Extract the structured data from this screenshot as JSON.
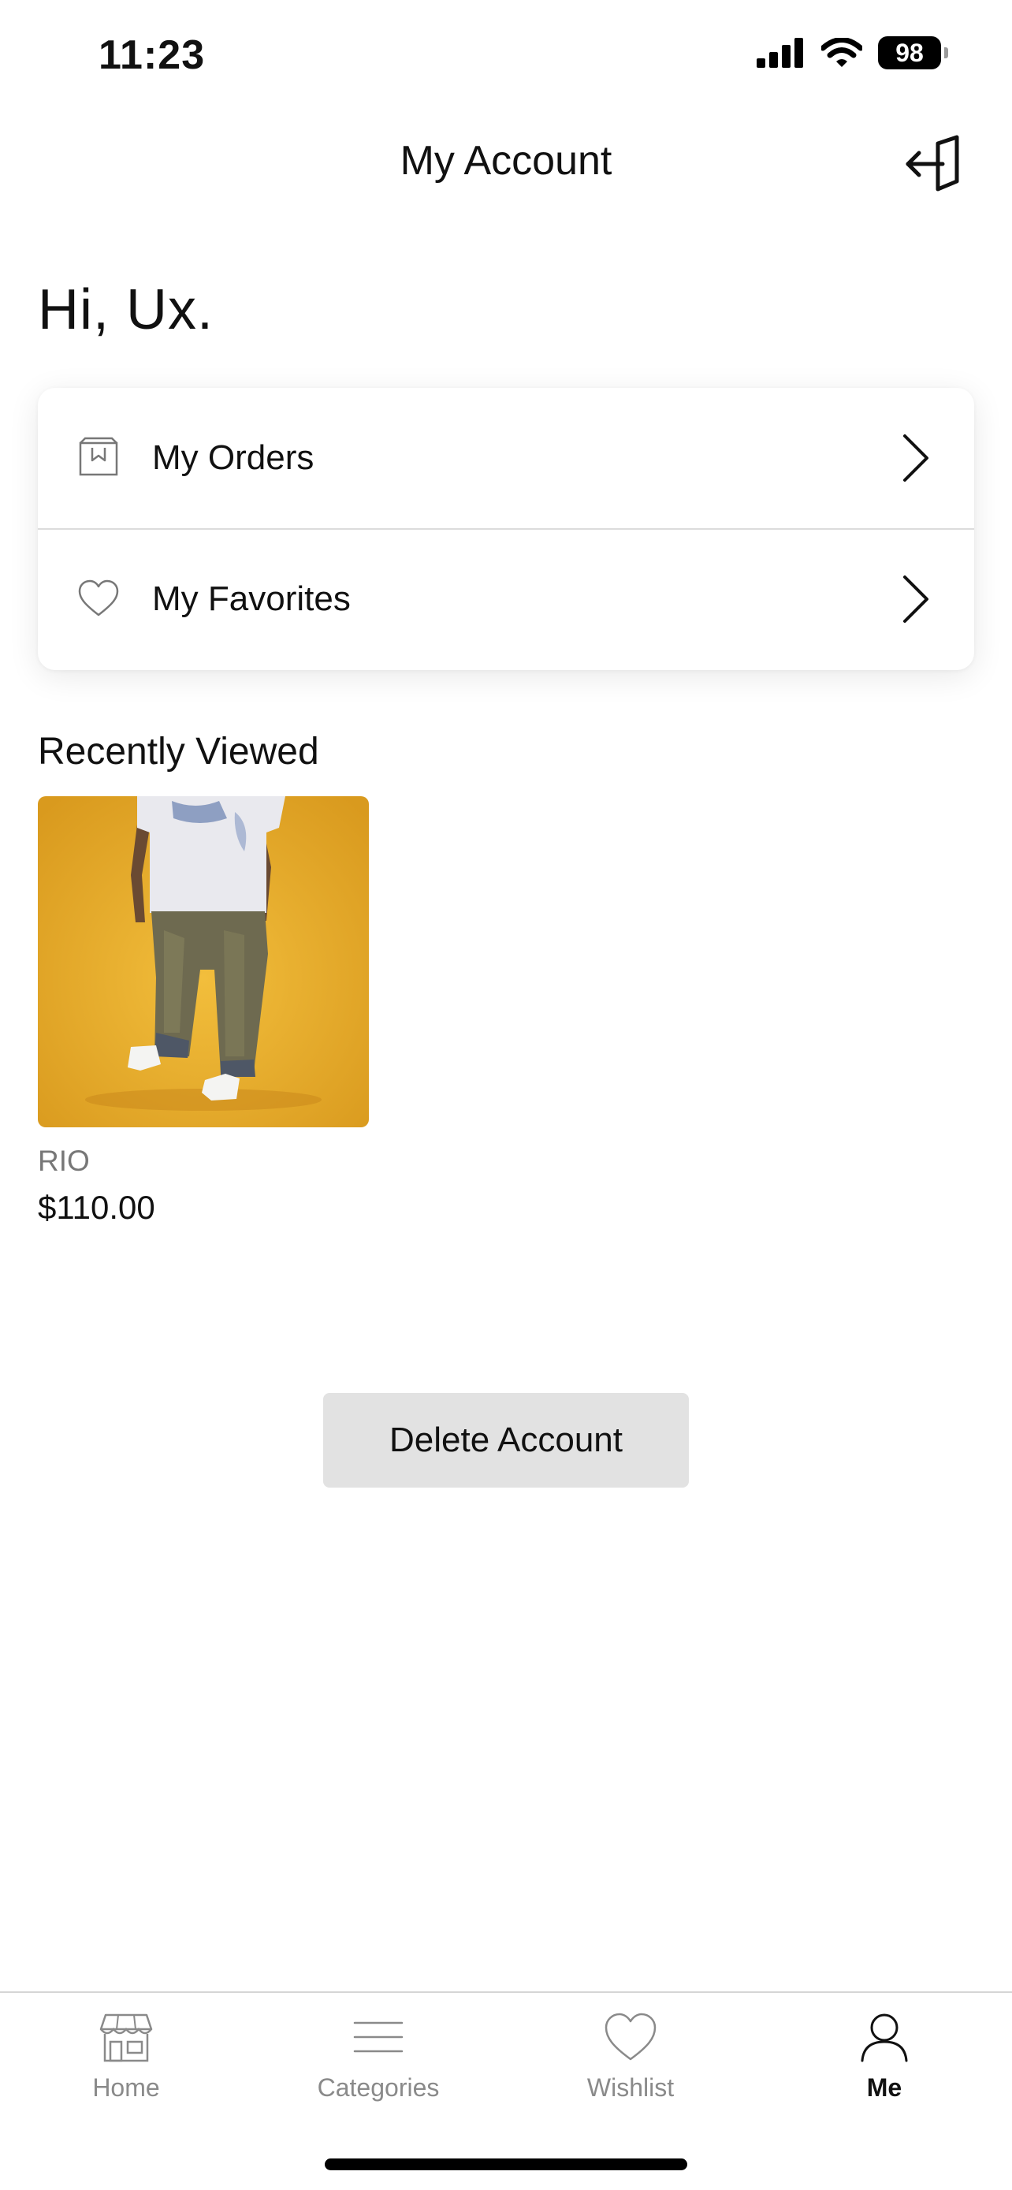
{
  "status_bar": {
    "time": "11:23",
    "battery": "98"
  },
  "header": {
    "title": "My Account"
  },
  "greeting": "Hi, Ux.",
  "menu": {
    "items": [
      {
        "label": "My Orders",
        "icon": "orders-bag-icon"
      },
      {
        "label": "My Favorites",
        "icon": "heart-icon"
      }
    ]
  },
  "recently_viewed": {
    "title": "Recently Viewed",
    "items": [
      {
        "brand": "RIO",
        "price": "$110.00"
      }
    ]
  },
  "delete_account_label": "Delete Account",
  "tab_bar": {
    "tabs": [
      {
        "label": "Home",
        "icon": "store-icon"
      },
      {
        "label": "Categories",
        "icon": "menu-lines-icon"
      },
      {
        "label": "Wishlist",
        "icon": "heart-icon"
      },
      {
        "label": "Me",
        "icon": "person-icon",
        "active": true
      }
    ]
  },
  "colors": {
    "product_background": "#E9AE2E",
    "delete_button_bg": "#E2E2E2",
    "tab_inactive": "#8A8A8A",
    "tab_active": "#111111"
  }
}
